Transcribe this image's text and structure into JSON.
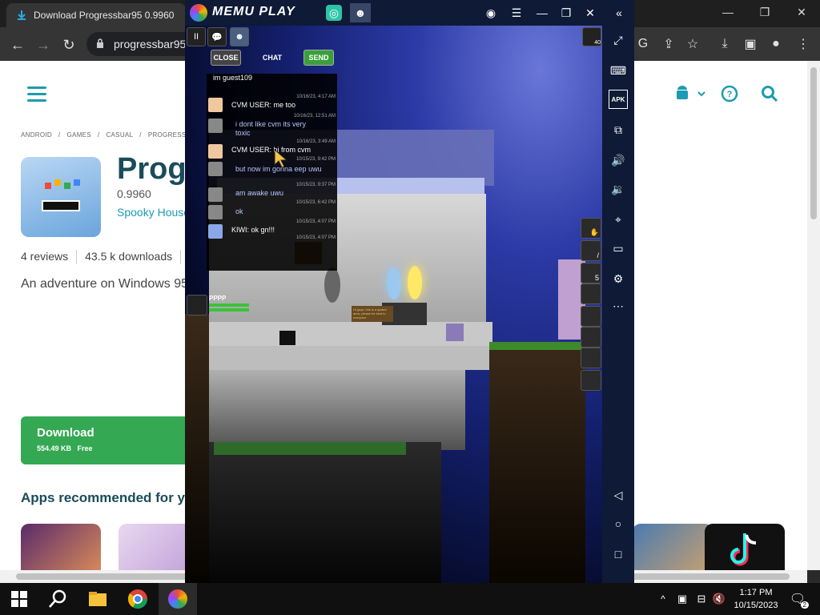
{
  "browser": {
    "tab_title": "Download Progressbar95 0.9960",
    "tab_close": "×",
    "url": "progressbar95",
    "win_minimize": "—",
    "win_restore": "❐",
    "win_close": "✕"
  },
  "page": {
    "breadcrumbs": [
      "ANDROID",
      "/",
      "GAMES",
      "/",
      "CASUAL",
      "/",
      "PROGRESSBAR95"
    ],
    "app_title": "Progr",
    "version": "0.9960",
    "developer": "Spooky House",
    "reviews": "4 reviews",
    "downloads": "43.5 k downloads",
    "description": "An adventure on Windows 95",
    "download_label": "Download",
    "download_size": "554.49 KB",
    "download_price": "Free",
    "recommended_heading": "Apps recommended for y"
  },
  "memu": {
    "logo": "MEMU PLAY",
    "sidebar_labels": [
      "APK"
    ],
    "chat": {
      "close_label": "CLOSE",
      "title": "CHAT",
      "send_label": "SEND",
      "input_text": "im guest109",
      "messages": [
        {
          "text": "CVM USER: me too",
          "time": "10/16/23, 4:17 AM",
          "light": false
        },
        {
          "text": "i dont like cvm its very",
          "text2": "toxic",
          "time": "10/16/23, 12:51 AM",
          "light": true
        },
        {
          "text": "CVM USER: hi from cvm",
          "time": "10/16/23, 3:49 AM",
          "light": false
        },
        {
          "text": "but now im gonna eep uwu",
          "time": "10/15/23, 9:42 PM",
          "light": true
        },
        {
          "text": "am awake uwu",
          "time": "10/15/23, 9:37 PM",
          "light": true
        },
        {
          "text": "ok",
          "time": "10/15/23, 6:42 PM",
          "light": true
        },
        {
          "text": "KIWI: ok gn!!!",
          "time": "10/15/23, 4:07 PM",
          "light": false
        }
      ],
      "last_time": "10/15/23, 4:07 PM"
    },
    "player_name": "PPPP",
    "top_counter": "40",
    "hotbar_count": "5",
    "sign_text": "Hi guys, this is a spawn area, please be kind to everyone"
  },
  "taskbar": {
    "time": "1:17 PM",
    "date": "10/15/2023",
    "notification_count": "2"
  },
  "colors": {
    "accent": "#1d9bb0",
    "download_green": "#34a853",
    "memu_bar": "#0e1a36",
    "title_dark": "#1a4c5a"
  }
}
